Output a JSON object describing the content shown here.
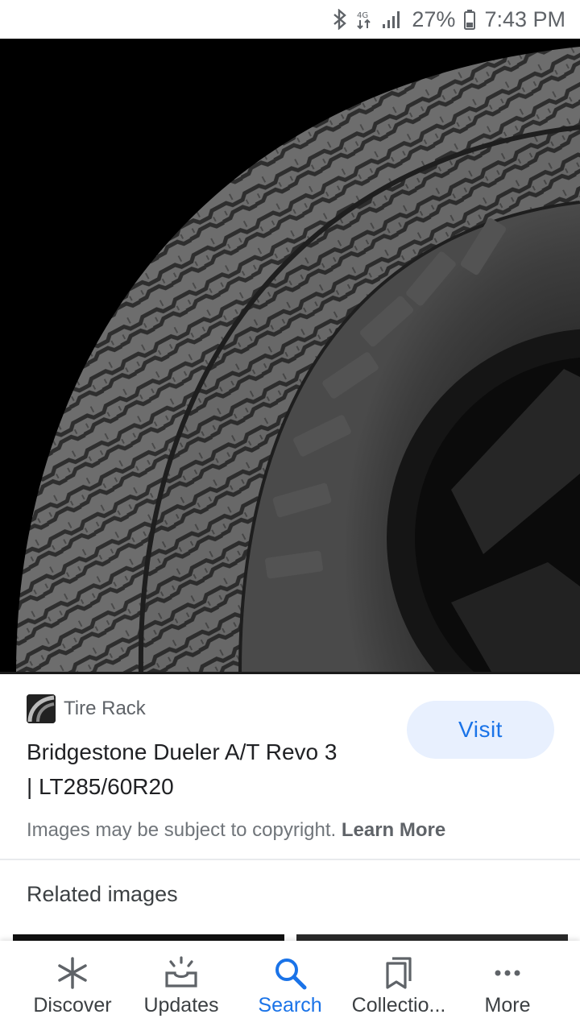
{
  "status_bar": {
    "battery_percent": "27%",
    "time": "7:43 PM"
  },
  "result": {
    "source_name": "Tire Rack",
    "title_line1": "Bridgestone Dueler A/T Revo 3",
    "title_line2": "| LT285/60R20",
    "visit_label": "Visit",
    "copyright_text": "Images may be subject to copyright.",
    "learn_more_label": "Learn More"
  },
  "related": {
    "heading": "Related images"
  },
  "bottom_nav": {
    "items": [
      {
        "label": "Discover",
        "icon": "asterisk-icon"
      },
      {
        "label": "Updates",
        "icon": "inbox-icon"
      },
      {
        "label": "Search",
        "icon": "search-icon"
      },
      {
        "label": "Collectio...",
        "icon": "bookmarks-icon"
      },
      {
        "label": "More",
        "icon": "more-dots-icon"
      }
    ],
    "active": "Search"
  },
  "colors": {
    "accent": "#1a73e8",
    "visit_bg": "#e8f0fe"
  }
}
